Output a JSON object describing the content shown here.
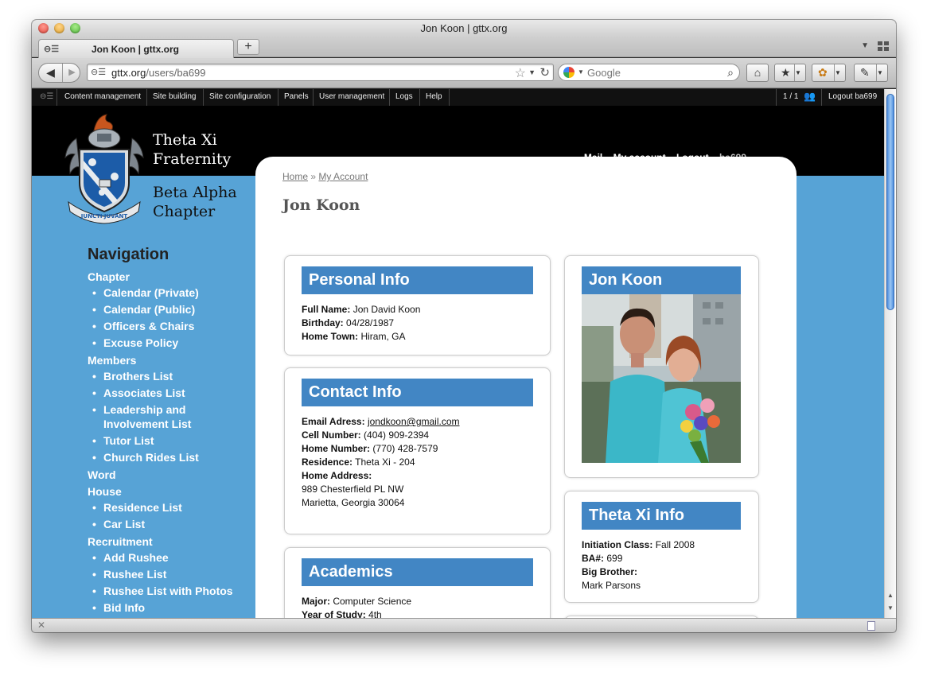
{
  "window": {
    "title": "Jon Koon | gttx.org"
  },
  "tab": {
    "label": "Jon Koon | gttx.org",
    "new_tab": "+"
  },
  "toolbar": {
    "url_domain": "gttx.org",
    "url_path": "/users/ba699",
    "search_placeholder": "Google"
  },
  "admin_menu": {
    "items": [
      "Content management",
      "Site building",
      "Site configuration",
      "Panels",
      "User management",
      "Logs",
      "Help"
    ],
    "users_online": "1 / 1",
    "logout": "Logout ba699"
  },
  "site": {
    "logo_line1": "Theta Xi",
    "logo_line2": "Fraternity",
    "chapter_line1": "Beta Alpha",
    "chapter_line2": "Chapter",
    "crest_motto": "JUNCTI JUVANT"
  },
  "top_links": {
    "mail": "Mail",
    "my_account": "My account",
    "logout": "Logout",
    "username": "ba699"
  },
  "breadcrumb": {
    "home": "Home",
    "sep": "»",
    "current": "My Account"
  },
  "page_title": "Jon Koon",
  "sidebar": {
    "title": "Navigation",
    "sections": [
      {
        "label": "Chapter",
        "items": [
          "Calendar (Private)",
          "Calendar (Public)",
          "Officers & Chairs",
          "Excuse Policy"
        ]
      },
      {
        "label": "Members",
        "items": [
          "Brothers List",
          "Associates List",
          "Leadership and Involvement List",
          "Tutor List",
          "Church Rides List"
        ]
      },
      {
        "label": "Word",
        "items": []
      },
      {
        "label": "House",
        "items": [
          "Residence List",
          "Car List"
        ]
      },
      {
        "label": "Recruitment",
        "items": [
          "Add Rushee",
          "Rushee List",
          "Rushee List with Photos",
          "Bid Info"
        ]
      }
    ]
  },
  "personal_info": {
    "heading": "Personal Info",
    "full_name_label": "Full Name:",
    "full_name": "Jon David Koon",
    "birthday_label": "Birthday:",
    "birthday": "04/28/1987",
    "hometown_label": "Home Town:",
    "hometown": "Hiram, GA"
  },
  "contact_info": {
    "heading": "Contact Info",
    "email_label": "Email Adress:",
    "email": "jondkoon@gmail.com",
    "cell_label": "Cell Number:",
    "cell": "(404) 909-2394",
    "home_label": "Home Number:",
    "home": "(770) 428-7579",
    "residence_label": "Residence:",
    "residence": "Theta Xi - 204",
    "address_label": "Home Address:",
    "address_line1": "989 Chesterfield PL NW",
    "address_line2": "Marietta, Georgia 30064"
  },
  "academics": {
    "heading": "Academics",
    "major_label": "Major:",
    "major": "Computer Science",
    "year_label": "Year of Study:",
    "year": "4th"
  },
  "profile_card": {
    "heading": "Jon Koon"
  },
  "theta_xi_info": {
    "heading": "Theta Xi Info",
    "initiation_label": "Initiation Class:",
    "initiation": "Fall 2008",
    "ba_label": "BA#:",
    "ba": "699",
    "big_brother_label": "Big Brother:",
    "big_brother": "Mark Parsons"
  },
  "colors": {
    "accent": "#4286c4",
    "sidebar_bg": "#57a3d6",
    "header_bg": "#000000"
  }
}
